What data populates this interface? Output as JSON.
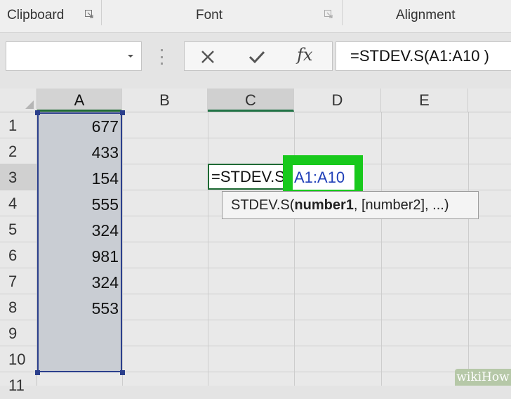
{
  "ribbon": {
    "groups": [
      "Clipboard",
      "Font",
      "Alignment"
    ]
  },
  "formula_bar": {
    "name_box": "",
    "cancel_icon": "close-icon",
    "enter_icon": "checkmark-icon",
    "fx_label": "fx",
    "formula": "=STDEV.S(A1:A10 )"
  },
  "columns": [
    "A",
    "B",
    "C",
    "D",
    "E"
  ],
  "rows": [
    "1",
    "2",
    "3",
    "4",
    "5",
    "6",
    "7",
    "8",
    "9",
    "10",
    "11"
  ],
  "column_a_values": [
    "677",
    "433",
    "154",
    "555",
    "324",
    "981",
    "324",
    "553",
    "",
    ""
  ],
  "active_cell": {
    "text_prefix": "=STDEV.S",
    "range_highlight": "A1:A10"
  },
  "tooltip": {
    "func": "STDEV.S(",
    "arg1": "number1",
    "rest": ", [number2], ...)"
  },
  "watermark": {
    "text": "wikiHow"
  },
  "colors": {
    "selection_border": "#2b3f8c",
    "active_cell_border": "#1f6a34",
    "highlight_green": "#18c91c",
    "range_text": "#1f3fb8"
  }
}
